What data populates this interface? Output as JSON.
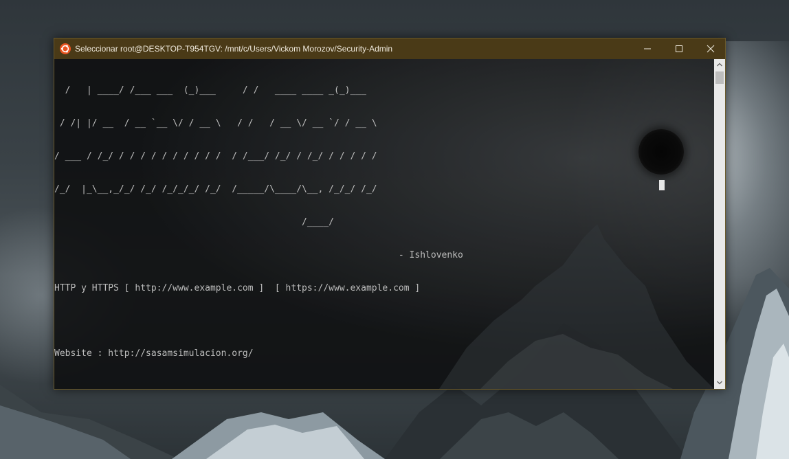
{
  "window": {
    "title": "Seleccionar root@DESKTOP-T954TGV: /mnt/c/Users/Vickom Morozov/Security-Admin",
    "title_bar_color": "#4a3a17",
    "icon": "ubuntu-icon"
  },
  "controls": {
    "minimize_icon": "minimize-icon",
    "maximize_icon": "maximize-icon",
    "close_icon": "close-icon"
  },
  "terminal": {
    "banner": [
      "  /   | ____/ /___ ___  (_)___     / /   ____ ____ _(_)___ ",
      " / /| |/ __  / __ `__ \\/ / __ \\   / /   / __ \\/ __ `/ / __ \\",
      "/ ___ / /_/ / / / / / / / / / /  / /___/ /_/ / /_/ / / / / /",
      "/_/  |_\\__,_/_/ /_/ /_/_/_/ /_/  /_____/\\____/\\__, /_/_/ /_/ ",
      "                                              /____/        "
    ],
    "signature": "                                                                - Ishlovenko",
    "https_line": "HTTP y HTTPS [ http://www.example.com ]  [ https://www.example.com ]",
    "website_line": "Website : http://sasamsimulacion.org/",
    "separator": "-----------------------------------------------------------------------------------------------------------",
    "text_color": "#bdbdbd",
    "background": "#0e0f11"
  },
  "scrollbar": {
    "up_icon": "chevron-up-icon",
    "down_icon": "chevron-down-icon"
  }
}
